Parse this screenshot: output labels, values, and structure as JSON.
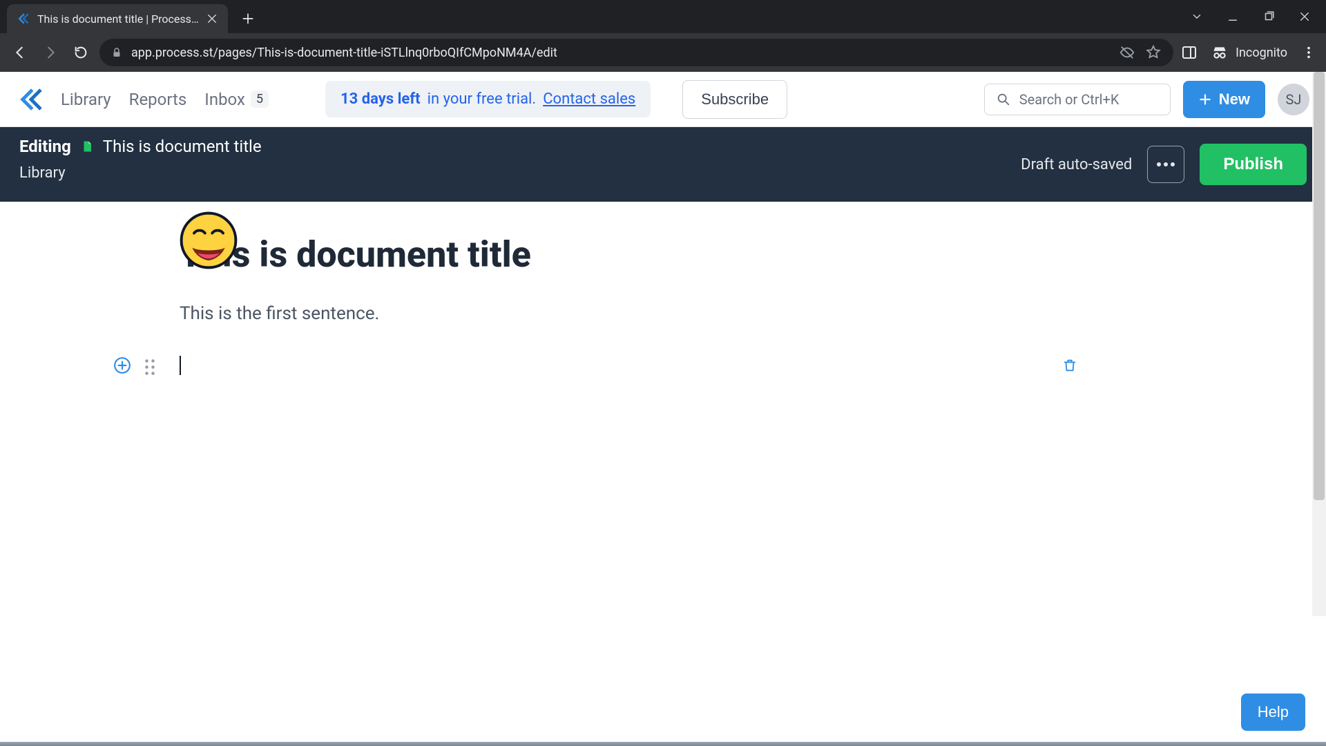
{
  "browser": {
    "tab_title": "This is document title | Process St",
    "url": "app.process.st/pages/This-is-document-title-iSTLlnq0rboQIfCMpoNM4A/edit",
    "incognito_label": "Incognito"
  },
  "nav": {
    "library": "Library",
    "reports": "Reports",
    "inbox_label": "Inbox",
    "inbox_count": "5",
    "trial_strong": "13 days left",
    "trial_rest": " in your free trial.",
    "contact_sales": "Contact sales",
    "subscribe": "Subscribe",
    "search_placeholder": "Search or Ctrl+K",
    "new_label": "New",
    "avatar_initials": "SJ"
  },
  "editing": {
    "label": "Editing",
    "doc_title": "This is document title",
    "breadcrumb": "Library",
    "autosave": "Draft auto-saved",
    "publish": "Publish"
  },
  "doc": {
    "title": "This is document title",
    "first_sentence": "This is the first sentence."
  },
  "help": {
    "label": "Help"
  }
}
